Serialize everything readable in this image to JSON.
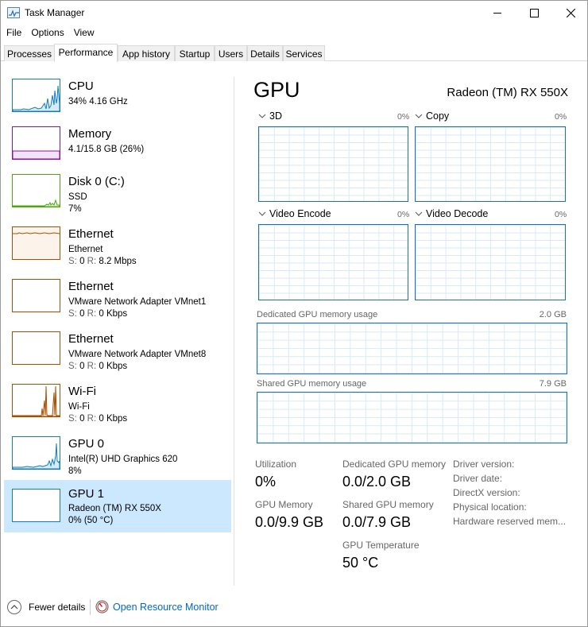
{
  "window": {
    "title": "Task Manager"
  },
  "menu": [
    "File",
    "Options",
    "View"
  ],
  "tabs": [
    "Processes",
    "Performance",
    "App history",
    "Startup",
    "Users",
    "Details",
    "Services"
  ],
  "active_tab": "Performance",
  "resources": [
    {
      "name": "CPU",
      "line1": "34%  4.16 GHz",
      "line2": "",
      "color": "#117dbb"
    },
    {
      "name": "Memory",
      "line1": "4.1/15.8 GB (26%)",
      "line2": "",
      "color": "#8b12ae"
    },
    {
      "name": "Disk 0 (C:)",
      "line1": "SSD",
      "line2": "7%",
      "color": "#4da60c"
    },
    {
      "name": "Ethernet",
      "line1": "Ethernet",
      "line2_s": "S: ",
      "line2_sv": "0",
      "line2_r": " R: ",
      "line2_rv": "8.2 Mbps",
      "color": "#a74f01"
    },
    {
      "name": "Ethernet",
      "line1": "VMware Network Adapter VMnet1",
      "line2_s": "S: ",
      "line2_sv": "0",
      "line2_r": " R: ",
      "line2_rv": "0 Kbps",
      "color": "#a74f01"
    },
    {
      "name": "Ethernet",
      "line1": "VMware Network Adapter VMnet8",
      "line2_s": "S: ",
      "line2_sv": "0",
      "line2_r": " R: ",
      "line2_rv": "0 Kbps",
      "color": "#a74f01"
    },
    {
      "name": "Wi-Fi",
      "line1": "Wi-Fi",
      "line2_s": "S: ",
      "line2_sv": "0",
      "line2_r": " R: ",
      "line2_rv": "0 Kbps",
      "color": "#a74f01"
    },
    {
      "name": "GPU 0",
      "line1": "Intel(R) UHD Graphics 620",
      "line2": "8%",
      "color": "#117dbb"
    },
    {
      "name": "GPU 1",
      "line1": "Radeon (TM) RX 550X",
      "line2": "0%  (50 °C)",
      "color": "#117dbb"
    }
  ],
  "gpu": {
    "title": "GPU",
    "model": "Radeon (TM) RX 550X",
    "engines": [
      {
        "label": "3D",
        "pct": "0%"
      },
      {
        "label": "Copy",
        "pct": "0%"
      },
      {
        "label": "Video Encode",
        "pct": "0%"
      },
      {
        "label": "Video Decode",
        "pct": "0%"
      }
    ],
    "dedicated_label": "Dedicated GPU memory usage",
    "dedicated_max": "2.0 GB",
    "shared_label": "Shared GPU memory usage",
    "shared_max": "7.9 GB",
    "stats": {
      "utilization_label": "Utilization",
      "utilization": "0%",
      "dedicated_label": "Dedicated GPU memory",
      "dedicated": "0.0/2.0 GB",
      "gpu_memory_label": "GPU Memory",
      "gpu_memory": "0.0/9.9 GB",
      "shared_label": "Shared GPU memory",
      "shared": "0.0/7.9 GB",
      "temp_label": "GPU Temperature",
      "temp": "50 °C"
    },
    "info": [
      "Driver version:",
      "Driver date:",
      "DirectX version:",
      "Physical location:",
      "Hardware reserved mem..."
    ]
  },
  "footer": {
    "fewer_details": "Fewer details",
    "open_resource_monitor": "Open Resource Monitor"
  }
}
